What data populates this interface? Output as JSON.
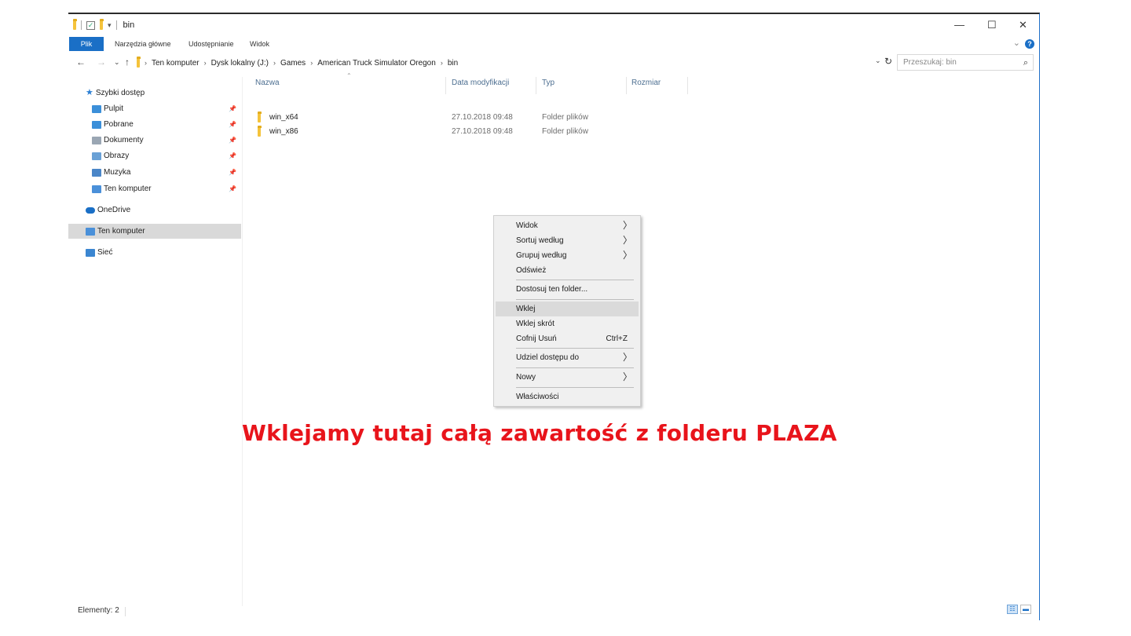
{
  "window": {
    "title": "bin",
    "minimize_label": "—",
    "maximize_label": "☐",
    "close_label": "✕"
  },
  "ribbon": {
    "tabs": [
      "Plik",
      "Narzędzia główne",
      "Udostępnianie",
      "Widok"
    ],
    "help_label": "?"
  },
  "address": {
    "breadcrumbs": [
      "Ten komputer",
      "Dysk lokalny (J:)",
      "Games",
      "American Truck Simulator Oregon",
      "bin"
    ],
    "search_placeholder": "Przeszukaj: bin"
  },
  "sidebar": {
    "quick_access": "Szybki dostęp",
    "items": [
      {
        "label": "Pulpit",
        "icon": "desktop-icon",
        "color": "#3b8fd9"
      },
      {
        "label": "Pobrane",
        "icon": "download-icon",
        "color": "#3b8fd9"
      },
      {
        "label": "Dokumenty",
        "icon": "documents-icon",
        "color": "#9aa6b3"
      },
      {
        "label": "Obrazy",
        "icon": "pictures-icon",
        "color": "#6aa1d6"
      },
      {
        "label": "Muzyka",
        "icon": "music-icon",
        "color": "#4a86c8"
      },
      {
        "label": "Ten komputer",
        "icon": "computer-icon",
        "color": "#4a90d9"
      }
    ],
    "onedrive": "OneDrive",
    "this_pc": "Ten komputer",
    "network": "Sieć"
  },
  "columns": [
    "Nazwa",
    "Data modyfikacji",
    "Typ",
    "Rozmiar"
  ],
  "files": [
    {
      "name": "win_x64",
      "modified": "27.10.2018 09:48",
      "type": "Folder plików",
      "size": ""
    },
    {
      "name": "win_x86",
      "modified": "27.10.2018 09:48",
      "type": "Folder plików",
      "size": ""
    }
  ],
  "context_menu": {
    "items": [
      {
        "label": "Widok",
        "arrow": "〉"
      },
      {
        "label": "Sortuj według",
        "arrow": "〉"
      },
      {
        "label": "Grupuj według",
        "arrow": "〉"
      },
      {
        "label": "Odśwież"
      },
      {
        "label": "Dostosuj ten folder..."
      },
      {
        "label": "Wklej",
        "highlighted": true
      },
      {
        "label": "Wklej skrót"
      },
      {
        "label": "Cofnij Usuń",
        "shortcut": "Ctrl+Z"
      },
      {
        "label": "Udziel dostępu do",
        "arrow": "〉"
      },
      {
        "label": "Nowy",
        "arrow": "〉"
      },
      {
        "label": "Właściwości"
      }
    ]
  },
  "status": {
    "items_count": "Elementy: 2"
  },
  "annotation": "Wklejamy tutaj całą zawartość z folderu PLAZA",
  "colors": {
    "accent": "#1a6fc6",
    "annotation": "#e8141b",
    "folder": "#f5c33b"
  }
}
